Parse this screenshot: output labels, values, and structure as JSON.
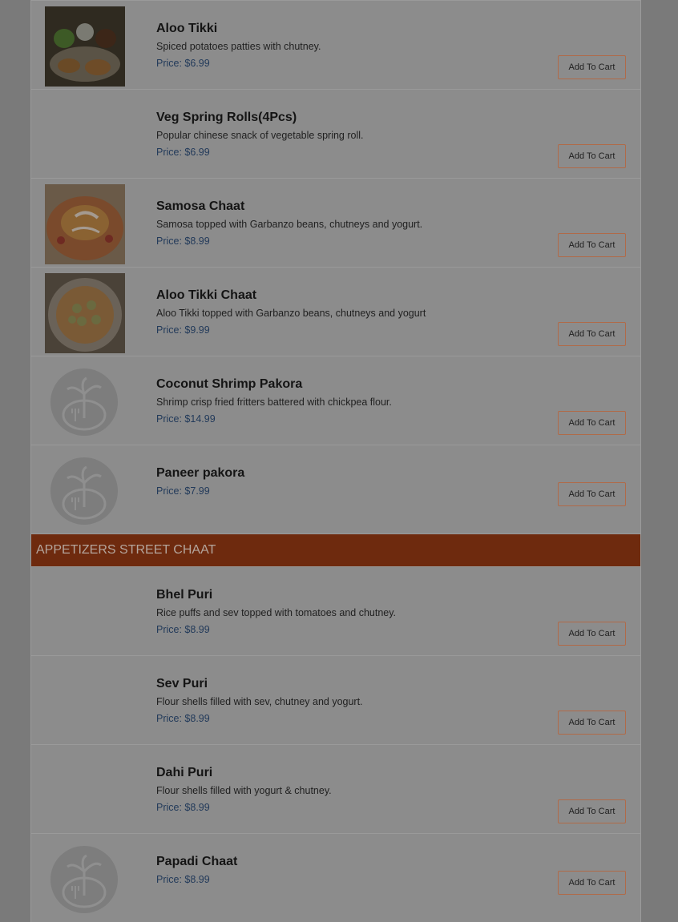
{
  "colors": {
    "category_bar": "#6e2a0e",
    "price_text": "#223a5a",
    "button_border": "#b06a48",
    "overlay": "#7a7a7a"
  },
  "items_top": [
    {
      "name": "Aloo Tikki",
      "desc": "Spiced potatoes patties with chutney.",
      "price": "Price: $6.99",
      "cart": "Add To Cart",
      "image": "photo-aloo-tikki"
    },
    {
      "name": "Veg Spring Rolls(4Pcs)",
      "desc": "Popular chinese snack of vegetable spring roll.",
      "price": "Price: $6.99",
      "cart": "Add To Cart",
      "image": "none"
    },
    {
      "name": "Samosa Chaat",
      "desc": "Samosa topped with Garbanzo beans, chutneys and yogurt.",
      "price": "Price: $8.99",
      "cart": "Add To Cart",
      "image": "photo-samosa-chaat"
    },
    {
      "name": "Aloo Tikki Chaat",
      "desc": "Aloo Tikki topped with Garbanzo beans, chutneys and yogurt",
      "price": "Price: $9.99",
      "cart": "Add To Cart",
      "image": "photo-aloo-tikki-chaat"
    },
    {
      "name": "Coconut Shrimp Pakora",
      "desc": "Shrimp crisp fried fritters battered with chickpea flour.",
      "price": "Price: $14.99",
      "cart": "Add To Cart",
      "image": "placeholder-logo"
    },
    {
      "name": "Paneer pakora",
      "desc": "",
      "price": "Price: $7.99",
      "cart": "Add To Cart",
      "image": "placeholder-logo"
    }
  ],
  "category": {
    "title": "APPETIZERS STREET CHAAT"
  },
  "items_chaat": [
    {
      "name": "Bhel Puri",
      "desc": "Rice puffs and sev topped with tomatoes and chutney.",
      "price": "Price: $8.99",
      "cart": "Add To Cart",
      "image": "none"
    },
    {
      "name": "Sev Puri",
      "desc": "Flour shells filled with sev, chutney and yogurt.",
      "price": "Price: $8.99",
      "cart": "Add To Cart",
      "image": "none"
    },
    {
      "name": "Dahi Puri",
      "desc": "Flour shells filled with yogurt & chutney.",
      "price": "Price: $8.99",
      "cart": "Add To Cart",
      "image": "none"
    },
    {
      "name": "Papadi Chaat",
      "desc": "",
      "price": "Price: $8.99",
      "cart": "Add To Cart",
      "image": "placeholder-logo"
    }
  ]
}
